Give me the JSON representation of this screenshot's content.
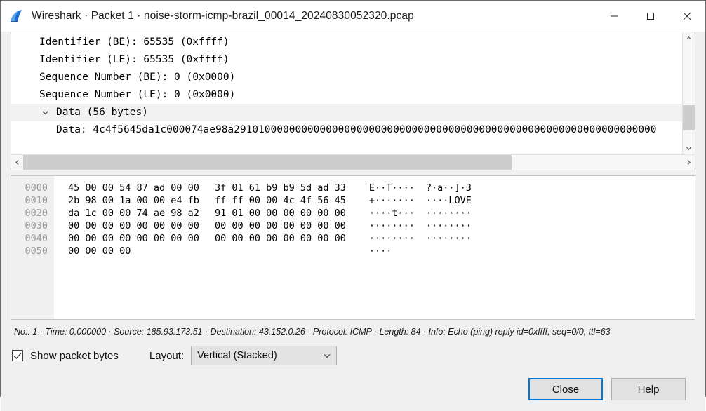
{
  "window": {
    "title": "Wireshark · Packet 1 · noise-storm-icmp-brazil_00014_20240830052320.pcap",
    "app_icon": "wireshark-fin-icon",
    "controls": {
      "minimize": "minimize-icon",
      "maximize": "maximize-icon",
      "close": "close-icon"
    }
  },
  "detail_tree": {
    "rows": [
      {
        "text": "Identifier (BE): 65535 (0xffff)",
        "indent": 1,
        "chevron": "",
        "selected": false
      },
      {
        "text": "Identifier (LE): 65535 (0xffff)",
        "indent": 1,
        "chevron": "",
        "selected": false
      },
      {
        "text": "Sequence Number (BE): 0 (0x0000)",
        "indent": 1,
        "chevron": "",
        "selected": false
      },
      {
        "text": "Sequence Number (LE): 0 (0x0000)",
        "indent": 1,
        "chevron": "",
        "selected": false
      },
      {
        "text": "Data (56 bytes)",
        "indent": 0,
        "chevron": "chevron-down-icon",
        "selected": true
      },
      {
        "text": "Data: 4c4f5645da1c000074ae98a291010000000000000000000000000000000000000000000000000000000000000000",
        "indent": 2,
        "chevron": "",
        "selected": false
      }
    ],
    "vertical_scrollbar": {
      "up": "chevron-up-icon",
      "down": "chevron-down-icon"
    },
    "horizontal_scrollbar": {
      "left": "chevron-left-icon",
      "right": "chevron-right-icon"
    }
  },
  "hex_dump": {
    "rows": [
      {
        "offset": "0000",
        "hex_left": "45 00 00 54 87 ad 00 00",
        "hex_right": "3f 01 61 b9 b9 5d ad 33",
        "ascii_left": "E··T····",
        "ascii_right": "?·a··]·3"
      },
      {
        "offset": "0010",
        "hex_left": "2b 98 00 1a 00 00 e4 fb",
        "hex_right": "ff ff 00 00 4c 4f 56 45",
        "ascii_left": "+·······",
        "ascii_right": "····LOVE"
      },
      {
        "offset": "0020",
        "hex_left": "da 1c 00 00 74 ae 98 a2",
        "hex_right": "91 01 00 00 00 00 00 00",
        "ascii_left": "····t···",
        "ascii_right": "········"
      },
      {
        "offset": "0030",
        "hex_left": "00 00 00 00 00 00 00 00",
        "hex_right": "00 00 00 00 00 00 00 00",
        "ascii_left": "········",
        "ascii_right": "········"
      },
      {
        "offset": "0040",
        "hex_left": "00 00 00 00 00 00 00 00",
        "hex_right": "00 00 00 00 00 00 00 00",
        "ascii_left": "········",
        "ascii_right": "········"
      },
      {
        "offset": "0050",
        "hex_left": "00 00 00 00",
        "hex_right": "",
        "ascii_left": "····",
        "ascii_right": ""
      }
    ]
  },
  "status": {
    "text": "No.: 1 · Time: 0.000000 · Source: 185.93.173.51 · Destination: 43.152.0.26 · Protocol: ICMP · Length: 84 · Info: Echo (ping) reply id=0xffff, seq=0/0, ttl=63"
  },
  "options": {
    "show_packet_bytes_label": "Show packet bytes",
    "show_packet_bytes_checked": true,
    "check_icon": "check-icon",
    "layout_label": "Layout:",
    "layout_value": "Vertical (Stacked)",
    "layout_arrow": "chevron-down-icon",
    "layout_options": [
      "Vertical (Stacked)"
    ]
  },
  "footer": {
    "close_label": "Close",
    "help_label": "Help"
  },
  "colors": {
    "accent": "#0078d7",
    "window_bg": "#f0f0f0",
    "pane_bg": "#ffffff",
    "offset_text": "#9a9a9a",
    "scroll_thumb": "#cdcdcd"
  }
}
